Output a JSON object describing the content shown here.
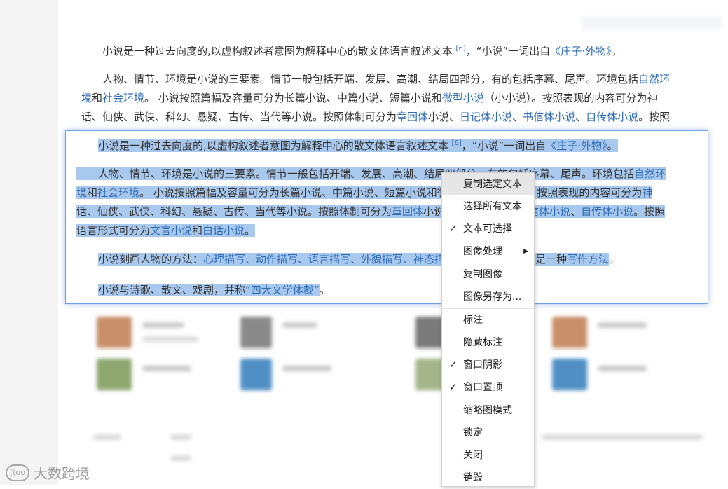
{
  "article": {
    "p1_a": "小说是一种过去向度的,以虚构叙述者意图为解释中心的散文体语言叙述文本 ",
    "p1_sup": "[6]",
    "p1_b": "，“小说”一词出自",
    "p1_link": "《庄子·外物》",
    "p1_c": "。",
    "p2_a": "人物、情节、环境是小说的三要素。情节一般包括开端、发展、高潮、结局四部分，有的包括序幕、尾声。环境包括",
    "p2_link1": "自然环",
    "p2_link1b": "境",
    "p2_b": "和",
    "p2_link2": "社会环境",
    "p2_c": "。 小说按照篇幅及容量可分为长篇小说、中篇小说、短篇小说和",
    "p2_link3": "微型小说",
    "p2_d": "（小小说）。按照表现的内容可分为神",
    "p2_e": "话、仙侠、武侠、科幻、悬疑、古传、当代等小说。按照体制可分为",
    "p2_link4": "章回体",
    "p2_f": "小说、",
    "p2_link5": "日记体小说",
    "p2_g": "、",
    "p2_link6": "书信体小说",
    "p2_h": "、",
    "p2_link7": "自传体小说",
    "p2_i": "。按照"
  },
  "overlay": {
    "p1_a": "小说是一种过去向度的,以虚构叙述者意图为解释中心的散文体语言叙述文本 ",
    "p1_sup": "[6]",
    "p1_b": "，“小说”一词出自",
    "p1_link": "《庄子·外物》",
    "p1_c": "。",
    "p2_l1a": "人物、情节、环境是小说的三要素。情节一般包括开端、发展、高潮、结局四部分，有的包括序幕、尾声。环境包括",
    "p2_l1link": "自然环",
    "p2_l2link1": "境",
    "p2_l2a": "和",
    "p2_l2link2": "社会环境",
    "p2_l2b": "。 小说按照篇幅及容量可分为长篇小说、中篇小说、短篇小说和微型小说（小小说）。按照表现的内容可分为",
    "p2_l2link3": "神",
    "p2_l3a": "话、仙侠、武侠、科幻、悬疑、古传、当代等小说。按照体制可分为",
    "p2_l3link1": "章回体",
    "p2_l3b": "小说、日记体小说、",
    "p2_l3link2": "书信体小说",
    "p2_l3c": "、",
    "p2_l3link3": "自传体小说",
    "p2_l3d": "。按照",
    "p2_l4a": "语言形式可分为",
    "p2_l4link1": "文言小说",
    "p2_l4b": "和",
    "p2_l4link2": "白话小说",
    "p2_l4c": "。",
    "p3_a": "小说刻画人物的方法：",
    "p3_links": "心理描写、动作描写、语言描写、外貌描写、神态描写、",
    "p3_b": "同时，小说是一种",
    "p3_link2": "写作方法",
    "p3_c": "。",
    "p4_a": "小说与诗歌、散文、戏剧，并称",
    "p4_link": "“四大文学体裁”",
    "p4_b": "。"
  },
  "context_menu": {
    "items": [
      {
        "label": "复制选定文本",
        "checked": false,
        "highlighted": true
      },
      {
        "label": "选择所有文本",
        "checked": false
      },
      {
        "label": "文本可选择",
        "checked": true
      },
      {
        "label": "图像处理",
        "checked": false,
        "submenu": true
      },
      {
        "label": "复制图像",
        "checked": false
      },
      {
        "label": "图像另存为...",
        "checked": false
      },
      {
        "label": "标注",
        "checked": false
      },
      {
        "label": "隐藏标注",
        "checked": false
      },
      {
        "label": "窗口阴影",
        "checked": true
      },
      {
        "label": "窗口置顶",
        "checked": true
      },
      {
        "label": "缩略图模式",
        "checked": false
      },
      {
        "label": "锁定",
        "checked": false
      },
      {
        "label": "关闭",
        "checked": false
      },
      {
        "label": "销毁",
        "checked": false
      }
    ],
    "check_glyph": "✓",
    "submenu_glyph": "▶"
  },
  "watermark": {
    "logo_text": "((oo",
    "text": "大数跨境"
  },
  "colors": {
    "link": "#2e6cb5",
    "selection": "#a9c8ee",
    "overlay_border": "#6ea0e8"
  }
}
